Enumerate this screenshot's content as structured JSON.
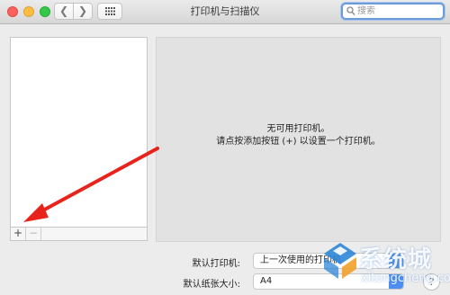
{
  "window": {
    "title": "打印机与扫描仪",
    "traffic_lights": {
      "close": "#fc605c",
      "minimize": "#fdbc40",
      "zoom": "#34c84a"
    }
  },
  "toolbar": {
    "back_glyph": "❮",
    "forward_glyph": "❯",
    "show_all_icon": "grid-icon"
  },
  "search": {
    "placeholder": "搜索"
  },
  "printer_list": {
    "items": [],
    "add_label": "+",
    "remove_label": "−"
  },
  "detail": {
    "line1": "无可用打印机。",
    "line2": "请点按添加按钮 (+) 以设置一个打印机。"
  },
  "settings": {
    "default_printer_label": "默认打印机:",
    "default_printer_value": "上一次使用的打印机",
    "paper_size_label": "默认纸张大小:",
    "paper_size_value": "A4",
    "help_label": "?"
  },
  "watermark": {
    "text": "系统城",
    "url": "xitongcheng.com"
  },
  "annotation": {
    "arrow_color": "#e8231c"
  },
  "accent": "#4d8ef1"
}
